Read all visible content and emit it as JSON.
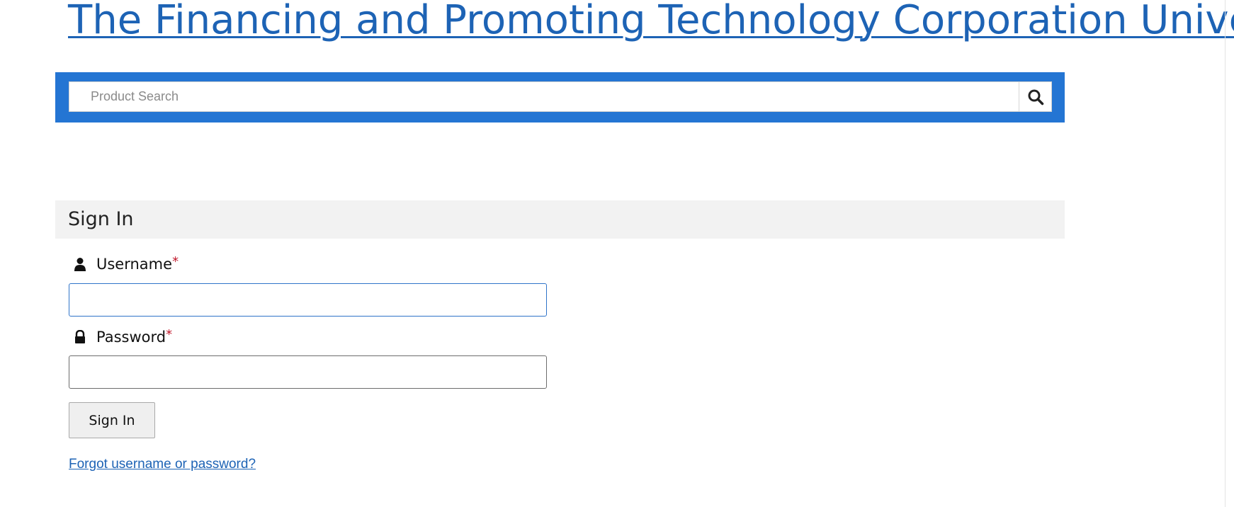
{
  "header": {
    "site_title": "The Financing and Promoting Technology Corporation Unive"
  },
  "search": {
    "placeholder": "Product Search",
    "value": "",
    "icon": "search-icon"
  },
  "signin": {
    "title": "Sign In",
    "username_label": "Username",
    "username_icon": "user-icon",
    "username_value": "",
    "password_label": "Password",
    "password_icon": "lock-icon",
    "password_value": "",
    "required_mark": "*",
    "button_label": "Sign In",
    "forgot_link": "Forgot username or password?"
  },
  "colors": {
    "brand_blue": "#2475d3",
    "link_blue": "#1d63b5",
    "required_red": "#c0182b",
    "header_gray": "#f2f2f2"
  }
}
